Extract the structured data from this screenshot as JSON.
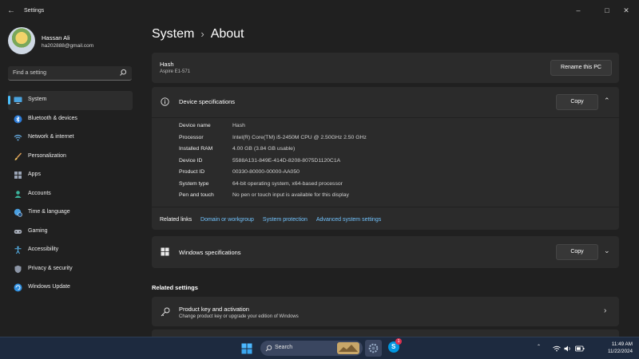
{
  "window": {
    "title": "Settings"
  },
  "profile": {
    "name": "Hassan Ali",
    "email": "ha202888@gmail.com"
  },
  "search": {
    "placeholder": "Find a setting"
  },
  "nav": {
    "items": [
      {
        "label": "System",
        "icon": "monitor-icon",
        "active": true
      },
      {
        "label": "Bluetooth & devices",
        "icon": "bluetooth-icon"
      },
      {
        "label": "Network & internet",
        "icon": "wifi-icon"
      },
      {
        "label": "Personalization",
        "icon": "brush-icon"
      },
      {
        "label": "Apps",
        "icon": "apps-icon"
      },
      {
        "label": "Accounts",
        "icon": "person-icon"
      },
      {
        "label": "Time & language",
        "icon": "globe-clock-icon"
      },
      {
        "label": "Gaming",
        "icon": "gamepad-icon"
      },
      {
        "label": "Accessibility",
        "icon": "accessibility-icon"
      },
      {
        "label": "Privacy & security",
        "icon": "shield-icon"
      },
      {
        "label": "Windows Update",
        "icon": "update-icon"
      }
    ]
  },
  "breadcrumb": {
    "parent": "System",
    "current": "About"
  },
  "pc": {
    "name": "Hash",
    "model": "Aspire E1-571",
    "rename_label": "Rename this PC"
  },
  "device_specs": {
    "title": "Device specifications",
    "copy_label": "Copy",
    "rows": [
      {
        "key": "Device name",
        "value": "Hash"
      },
      {
        "key": "Processor",
        "value": "Intel(R) Core(TM) i5-2450M CPU @ 2.50GHz   2.50 GHz"
      },
      {
        "key": "Installed RAM",
        "value": "4.00 GB (3.84 GB usable)"
      },
      {
        "key": "Device ID",
        "value": "5588A131-849E-414D-8208-8075D1120C1A"
      },
      {
        "key": "Product ID",
        "value": "00330-80000-00000-AA050"
      },
      {
        "key": "System type",
        "value": "64-bit operating system, x64-based processor"
      },
      {
        "key": "Pen and touch",
        "value": "No pen or touch input is available for this display"
      }
    ]
  },
  "related_links": {
    "title": "Related links",
    "links": [
      "Domain or workgroup",
      "System protection",
      "Advanced system settings"
    ]
  },
  "windows_specs": {
    "title": "Windows specifications",
    "copy_label": "Copy"
  },
  "related_settings": {
    "title": "Related settings",
    "items": [
      {
        "title": "Product key and activation",
        "subtitle": "Change product key or upgrade your edition of Windows",
        "icon": "key-icon"
      }
    ]
  },
  "taskbar": {
    "search_label": "Search",
    "notification_count": "1",
    "time": "11:49 AM",
    "date": "11/22/2024"
  },
  "colors": {
    "accent": "#4cc2ff",
    "link": "#72c4ff",
    "background": "#202020",
    "card": "#2b2b2b"
  }
}
